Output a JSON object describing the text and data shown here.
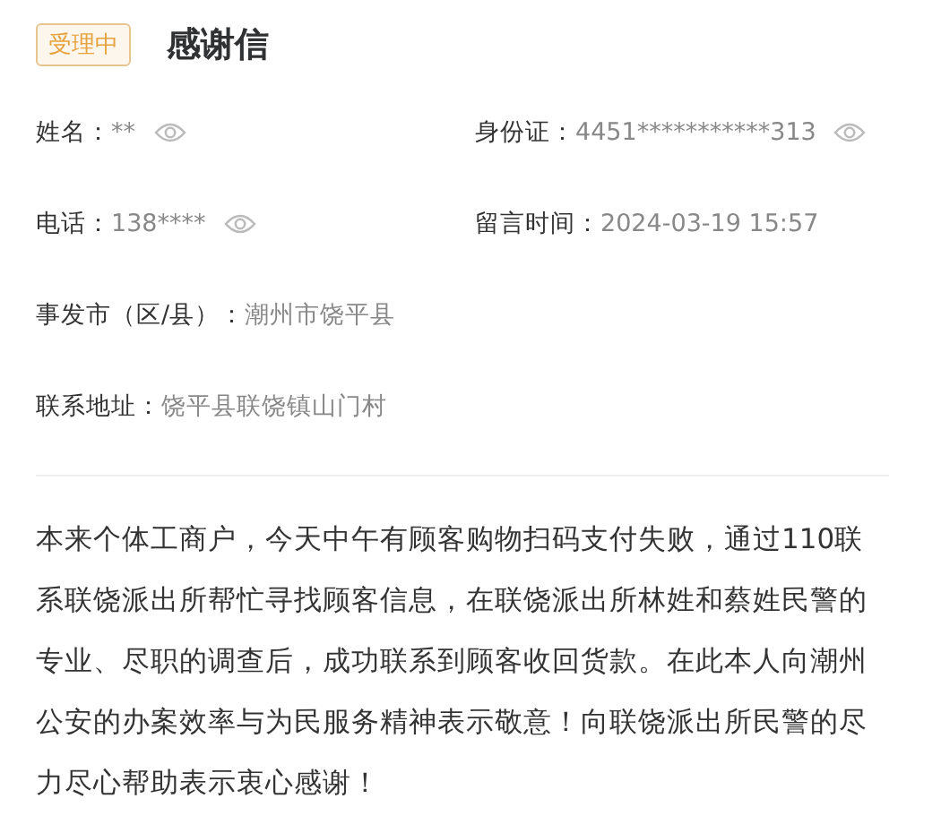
{
  "status_badge": "受理中",
  "title": "感谢信",
  "fields": [
    {
      "label": "姓名：",
      "value": "**",
      "revealable": true,
      "wide": false
    },
    {
      "label": "身份证：",
      "value": "4451***********313",
      "revealable": true,
      "wide": false
    },
    {
      "label": "电话：",
      "value": "138****",
      "revealable": true,
      "wide": false
    },
    {
      "label": "留言时间：",
      "value": "2024-03-19 15:57",
      "revealable": false,
      "wide": false
    },
    {
      "label": "事发市（区/县）：",
      "value": "潮州市饶平县",
      "revealable": false,
      "wide": true
    },
    {
      "label": "联系地址：",
      "value": "饶平县联饶镇山门村",
      "revealable": false,
      "wide": true
    }
  ],
  "message": "本来个体工商户，今天中午有顾客购物扫码支付失败，通过110联系联饶派出所帮忙寻找顾客信息，在联饶派出所林姓和蔡姓民警的专业、尽职的调查后，成功联系到顾客收回货款。在此本人向潮州公安的办案效率与为民服务精神表示敬意！向联饶派出所民警的尽力尽心帮助表示衷心感谢！"
}
